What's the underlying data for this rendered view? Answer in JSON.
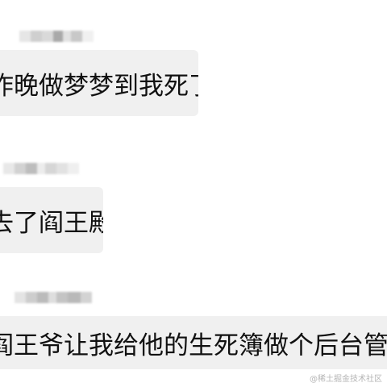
{
  "messages": [
    {
      "text": "昨晚做梦梦到我死了"
    },
    {
      "text": "去了阎王殿"
    },
    {
      "text": "阎王爷让我给他的生死簿做个后台管理系统"
    }
  ],
  "watermark": "@稀土掘金技术社区",
  "colors": {
    "bubble_background": "#f0f0f0",
    "page_background": "#ffffff",
    "text": "#111111"
  }
}
